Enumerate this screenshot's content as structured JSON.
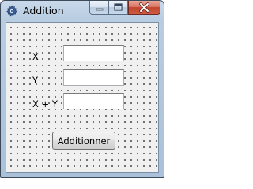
{
  "window": {
    "title": "Addition"
  },
  "form": {
    "x_label": "X",
    "y_label": "Y",
    "sum_label": "X + Y",
    "x_value": "",
    "y_value": "",
    "sum_value": "",
    "button_label": "Additionner"
  },
  "colors": {
    "titlebar": "#b9cde2",
    "client_background": "#f0f0f0",
    "grid_dots": "#2a2a2a",
    "close_button": "#c2432b"
  },
  "icons": {
    "app": "gear-icon",
    "minimize": "minimize-icon",
    "maximize": "maximize-icon",
    "close": "close-icon"
  }
}
